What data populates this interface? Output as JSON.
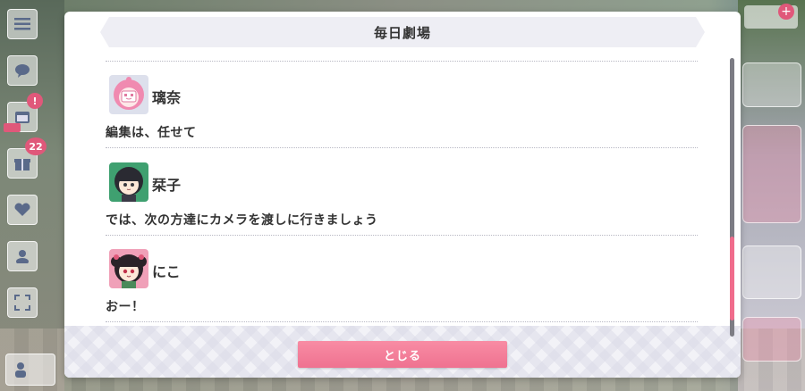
{
  "dialog": {
    "title": "毎日劇場",
    "entries": [
      {
        "speaker": "璃奈",
        "line": "編集は、任せて",
        "avatar_icon": "rina-avatar-icon",
        "avatar_color": "#f08ab0"
      },
      {
        "speaker": "栞子",
        "line": "では、次の方達にカメラを渡しに行きましょう",
        "avatar_icon": "shioriko-avatar-icon",
        "avatar_color": "#3fa070"
      },
      {
        "speaker": "にこ",
        "line": "おー！",
        "avatar_icon": "nico-avatar-icon",
        "avatar_color": "#e0587a"
      }
    ],
    "close_label": "とじる"
  },
  "hud_left": {
    "badge_count": "22"
  },
  "colors": {
    "accent_pink": "#f06c8c",
    "header_bg": "#eeeef4",
    "text": "#333333"
  }
}
